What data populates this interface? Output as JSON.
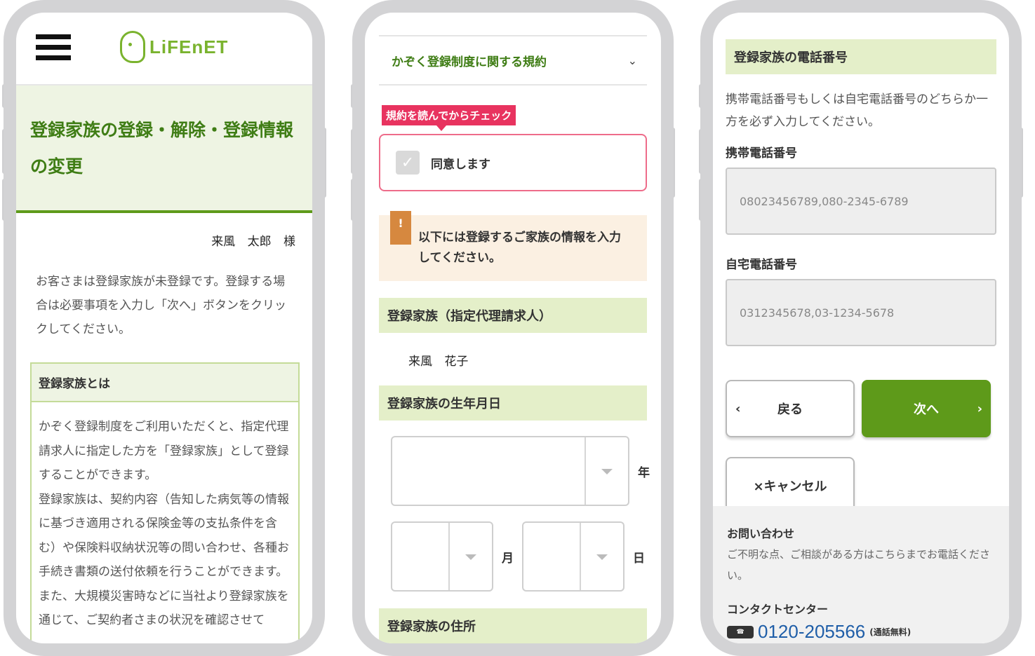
{
  "screen1": {
    "logo_text": "LiFEnET",
    "page_title": "登録家族の登録・解除・登録情報の変更",
    "user_name": "来風 太郎 様",
    "description": "お客さまは登録家族が未登録です。登録する場合は必要事項を入力し「次へ」ボタンをクリックしてください。",
    "info_heading": "登録家族とは",
    "info_paragraphs": [
      "かぞく登録制度をご利用いただくと、指定代理請求人に指定した方を「登録家族」として登録することができます。",
      "登録家族は、契約内容（告知した病気等の情報に基づき適用される保険金等の支払条件を含む）や保険料収納状況等の問い合わせ、各種お手続き書類の送付依頼を行うことができます。",
      "また、大規模災害時などに当社より登録家族を通じて、ご契約者さまの状況を確認させて"
    ]
  },
  "screen2": {
    "accordion_label": "かぞく登録制度に関する規約",
    "tooltip": "規約を読んでからチェック",
    "agree_label": "同意します",
    "notice": "以下には登録するご家族の情報を入力してください。",
    "notice_icon": "!",
    "section_family": "登録家族（指定代理請求人）",
    "family_name": "来風 花子",
    "section_birthday": "登録家族の生年月日",
    "year_unit": "年",
    "month_unit": "月",
    "day_unit": "日",
    "section_address": "登録家族の住所"
  },
  "screen3": {
    "section_phone": "登録家族の電話番号",
    "phone_desc": "携帯電話番号もしくは自宅電話番号のどちらか一方を必ず入力してください。",
    "mobile_label": "携帯電話番号",
    "mobile_placeholder": "08023456789,080-2345-6789",
    "home_label": "自宅電話番号",
    "home_placeholder": "0312345678,03-1234-5678",
    "back_label": "戻る",
    "next_label": "次へ",
    "cancel_label": "×キャンセル",
    "contact_title": "お問い合わせ",
    "contact_text": "ご不明な点、ご相談がある方はこちらまでお電話ください。",
    "contact_center": "コンタクトセンター",
    "contact_tel": "0120-205566",
    "contact_free": "(通話無料)"
  },
  "colors": {
    "brand_green": "#5e9a1a",
    "title_green": "#3f7d15",
    "alert_pink": "#e8335f",
    "notice_bg": "#fbf0e2"
  }
}
